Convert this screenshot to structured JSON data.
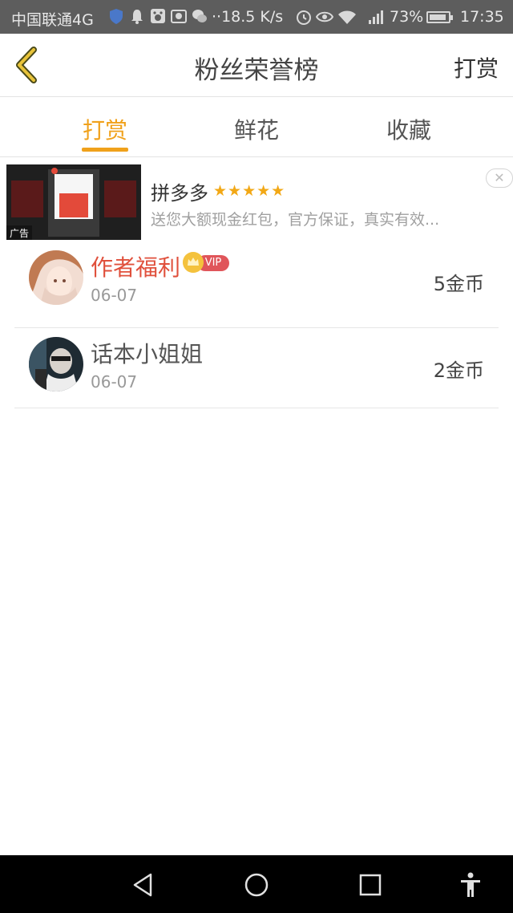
{
  "status_bar": {
    "carrier": "中国联通4G",
    "speed": "··18.5 K/s",
    "battery_percent": "73%",
    "time": "17:35",
    "icons": [
      "shield-icon",
      "bell-icon",
      "baidu-icon",
      "camera-icon",
      "wechat-icon",
      "alarm-icon",
      "eye-icon",
      "wifi-icon",
      "signal-icon",
      "battery-icon"
    ]
  },
  "header": {
    "title": "粉丝荣誉榜",
    "right_action": "打赏"
  },
  "tabs": [
    {
      "label": "打赏",
      "active": true
    },
    {
      "label": "鲜花",
      "active": false
    },
    {
      "label": "收藏",
      "active": false
    }
  ],
  "ad": {
    "tag": "广告",
    "name": "拼多多",
    "stars": "★★★★★",
    "description": "送您大额现金红包，官方保证，真实有效...",
    "close": "✕"
  },
  "list": [
    {
      "name": "作者福利",
      "vip": true,
      "vip_label": "VIP",
      "date": "06-07",
      "coins": "5金币"
    },
    {
      "name": "话本小姐姐",
      "vip": false,
      "date": "06-07",
      "coins": "2金币"
    }
  ],
  "colors": {
    "accent": "#f0a11b",
    "vip_name": "#e0503c",
    "status_bar": "#5d5d5d",
    "nav_bar": "#000000"
  },
  "nav_bar": {
    "buttons": [
      "back-triangle-icon",
      "home-circle-icon",
      "recent-square-icon",
      "accessibility-icon"
    ]
  }
}
